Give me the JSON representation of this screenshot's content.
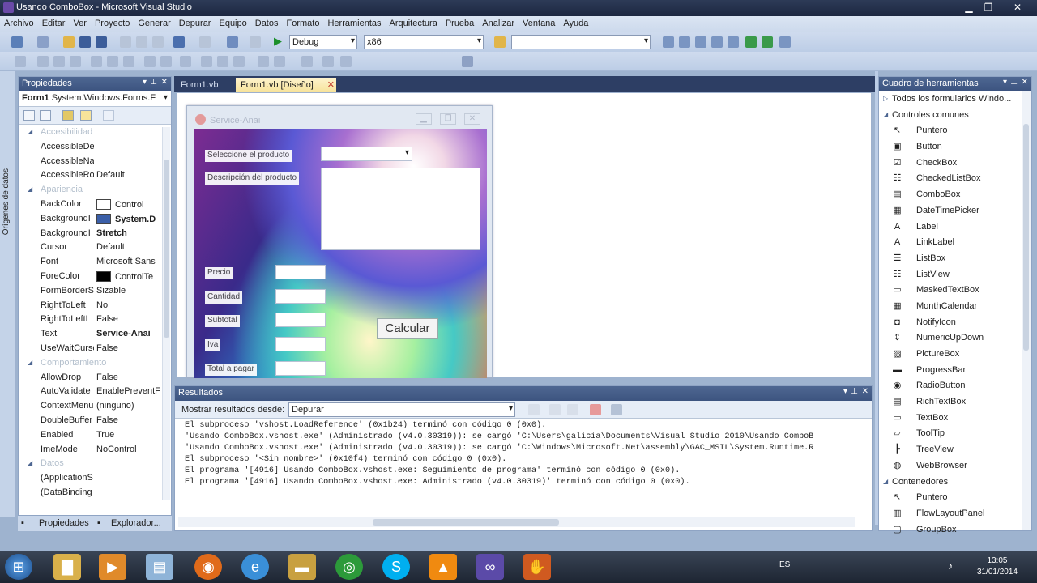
{
  "window": {
    "title": "Usando ComboBox - Microsoft Visual Studio",
    "min": "▁",
    "max": "❐",
    "close": "✕"
  },
  "menu": [
    "Archivo",
    "Editar",
    "Ver",
    "Proyecto",
    "Generar",
    "Depurar",
    "Equipo",
    "Datos",
    "Formato",
    "Herramientas",
    "Arquitectura",
    "Prueba",
    "Analizar",
    "Ventana",
    "Ayuda"
  ],
  "toolbar": {
    "config": "Debug",
    "platform": "x86",
    "find": ""
  },
  "left_strip": "Orígenes de datos",
  "properties": {
    "title": "Propiedades",
    "object": "Form1",
    "object_type": "System.Windows.Forms.F",
    "rows": [
      {
        "cat": true,
        "name": "Accesibilidad"
      },
      {
        "name": "AccessibleDe",
        "value": ""
      },
      {
        "name": "AccessibleNa",
        "value": ""
      },
      {
        "name": "AccessibleRo",
        "value": "Default"
      },
      {
        "cat": true,
        "name": "Apariencia"
      },
      {
        "name": "BackColor",
        "value": "Control",
        "swatch": "#ffffff"
      },
      {
        "name": "BackgroundI",
        "value": "System.D",
        "swatch": "#3b5fa8",
        "bold": true
      },
      {
        "name": "BackgroundI",
        "value": "Stretch",
        "bold": true
      },
      {
        "name": "Cursor",
        "value": "Default"
      },
      {
        "name": "Font",
        "value": "Microsoft Sans"
      },
      {
        "name": "ForeColor",
        "value": "ControlTe",
        "swatch": "#000000"
      },
      {
        "name": "FormBorderS",
        "value": "Sizable"
      },
      {
        "name": "RightToLeft",
        "value": "No"
      },
      {
        "name": "RightToLeftL",
        "value": "False"
      },
      {
        "name": "Text",
        "value": "Service-Anai",
        "bold": true
      },
      {
        "name": "UseWaitCurso",
        "value": "False"
      },
      {
        "cat": true,
        "name": "Comportamiento"
      },
      {
        "name": "AllowDrop",
        "value": "False"
      },
      {
        "name": "AutoValidate",
        "value": "EnablePreventF"
      },
      {
        "name": "ContextMenu",
        "value": "(ninguno)"
      },
      {
        "name": "DoubleBuffer",
        "value": "False"
      },
      {
        "name": "Enabled",
        "value": "True"
      },
      {
        "name": "ImeMode",
        "value": "NoControl"
      },
      {
        "cat": true,
        "name": "Datos"
      },
      {
        "name": "(ApplicationS",
        "value": ""
      },
      {
        "name": "(DataBinding",
        "value": ""
      }
    ],
    "tabs": [
      "Propiedades",
      "Explorador..."
    ]
  },
  "doc_tabs": [
    "Form1.vb",
    "Form1.vb [Diseño]"
  ],
  "form": {
    "title": "Service-Anai",
    "labels": [
      "Seleccione el producto",
      "Descripción del producto",
      "Precio",
      "Cantidad",
      "Subtotal",
      "Iva",
      "Total a pagar"
    ],
    "button": "Calcular"
  },
  "toolbox": {
    "title": "Cuadro de herramientas",
    "groups": [
      {
        "header": "Todos los formularios Windo..."
      },
      {
        "header": "Controles comunes",
        "expanded": true
      },
      {
        "icon": "pointer-icon",
        "glyph": "↖",
        "label": "Puntero"
      },
      {
        "icon": "button-icon",
        "glyph": "▣",
        "label": "Button"
      },
      {
        "icon": "checkbox-icon",
        "glyph": "☑",
        "label": "CheckBox"
      },
      {
        "icon": "checkedlistbox-icon",
        "glyph": "☷",
        "label": "CheckedListBox"
      },
      {
        "icon": "combobox-icon",
        "glyph": "▤",
        "label": "ComboBox"
      },
      {
        "icon": "datetimepicker-icon",
        "glyph": "▦",
        "label": "DateTimePicker"
      },
      {
        "icon": "label-icon",
        "glyph": "A",
        "label": "Label"
      },
      {
        "icon": "linklabel-icon",
        "glyph": "A",
        "label": "LinkLabel"
      },
      {
        "icon": "listbox-icon",
        "glyph": "☰",
        "label": "ListBox"
      },
      {
        "icon": "listview-icon",
        "glyph": "☷",
        "label": "ListView"
      },
      {
        "icon": "maskedtextbox-icon",
        "glyph": "▭",
        "label": "MaskedTextBox"
      },
      {
        "icon": "monthcalendar-icon",
        "glyph": "▦",
        "label": "MonthCalendar"
      },
      {
        "icon": "notifyicon-icon",
        "glyph": "◘",
        "label": "NotifyIcon"
      },
      {
        "icon": "numericupdown-icon",
        "glyph": "⇕",
        "label": "NumericUpDown"
      },
      {
        "icon": "picturebox-icon",
        "glyph": "▨",
        "label": "PictureBox"
      },
      {
        "icon": "progressbar-icon",
        "glyph": "▬",
        "label": "ProgressBar"
      },
      {
        "icon": "radiobutton-icon",
        "glyph": "◉",
        "label": "RadioButton"
      },
      {
        "icon": "richtextbox-icon",
        "glyph": "▤",
        "label": "RichTextBox"
      },
      {
        "icon": "textbox-icon",
        "glyph": "▭",
        "label": "TextBox"
      },
      {
        "icon": "tooltip-icon",
        "glyph": "▱",
        "label": "ToolTip"
      },
      {
        "icon": "treeview-icon",
        "glyph": "┣",
        "label": "TreeView"
      },
      {
        "icon": "webbrowser-icon",
        "glyph": "◍",
        "label": "WebBrowser"
      },
      {
        "header": "Contenedores",
        "expanded": true
      },
      {
        "icon": "pointer-icon",
        "glyph": "↖",
        "label": "Puntero"
      },
      {
        "icon": "flowlayoutpanel-icon",
        "glyph": "▥",
        "label": "FlowLayoutPanel"
      },
      {
        "icon": "groupbox-icon",
        "glyph": "▢",
        "label": "GroupBox"
      }
    ]
  },
  "results": {
    "title": "Resultados",
    "show_label": "Mostrar resultados desde:",
    "show_value": "Depurar",
    "lines": [
      "El subproceso 'vshost.LoadReference' (0x1b24) terminó con código 0 (0x0).",
      "'Usando ComboBox.vshost.exe' (Administrado (v4.0.30319)): se cargó 'C:\\Users\\galicia\\Documents\\Visual Studio 2010\\Usando ComboB",
      "'Usando ComboBox.vshost.exe' (Administrado (v4.0.30319)): se cargó 'C:\\Windows\\Microsoft.Net\\assembly\\GAC_MSIL\\System.Runtime.R",
      "El subproceso '<Sin nombre>' (0x10f4) terminó con código 0 (0x0).",
      "El programa '[4916] Usando ComboBox.vshost.exe: Seguimiento de programa' terminó con código 0 (0x0).",
      "El programa '[4916] Usando ComboBox.vshost.exe: Administrado (v4.0.30319)' terminó con código 0 (0x0)."
    ]
  },
  "taskbar": {
    "lang": "ES",
    "time": "13:05",
    "date": "31/01/2014"
  }
}
